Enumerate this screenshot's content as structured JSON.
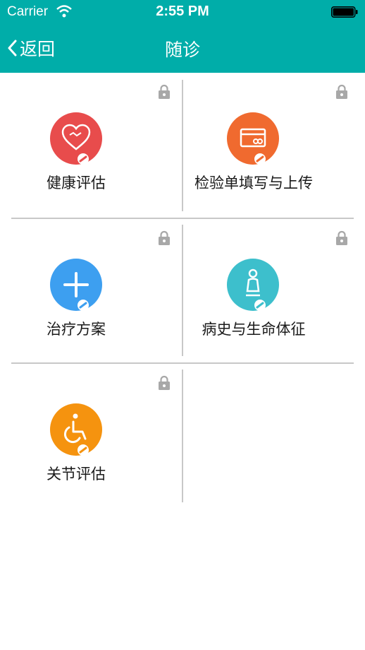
{
  "status_bar": {
    "carrier": "Carrier",
    "time": "2:55 PM"
  },
  "nav": {
    "back_label": "返回",
    "title": "随诊"
  },
  "tiles": [
    {
      "label": "健康评估",
      "color": "#e84c4c",
      "icon": "heart-icon"
    },
    {
      "label": "检验单填写与上传",
      "color": "#f06a2f",
      "icon": "card-icon"
    },
    {
      "label": "治疗方案",
      "color": "#3d9ff0",
      "icon": "plus-icon"
    },
    {
      "label": "病史与生命体征",
      "color": "#3dbfcc",
      "icon": "person-icon"
    },
    {
      "label": "关节评估",
      "color": "#f5930f",
      "icon": "wheelchair-icon"
    }
  ],
  "colors": {
    "header": "#00ada9",
    "divider": "#c8c8c8",
    "lock": "#a8a8a8"
  }
}
